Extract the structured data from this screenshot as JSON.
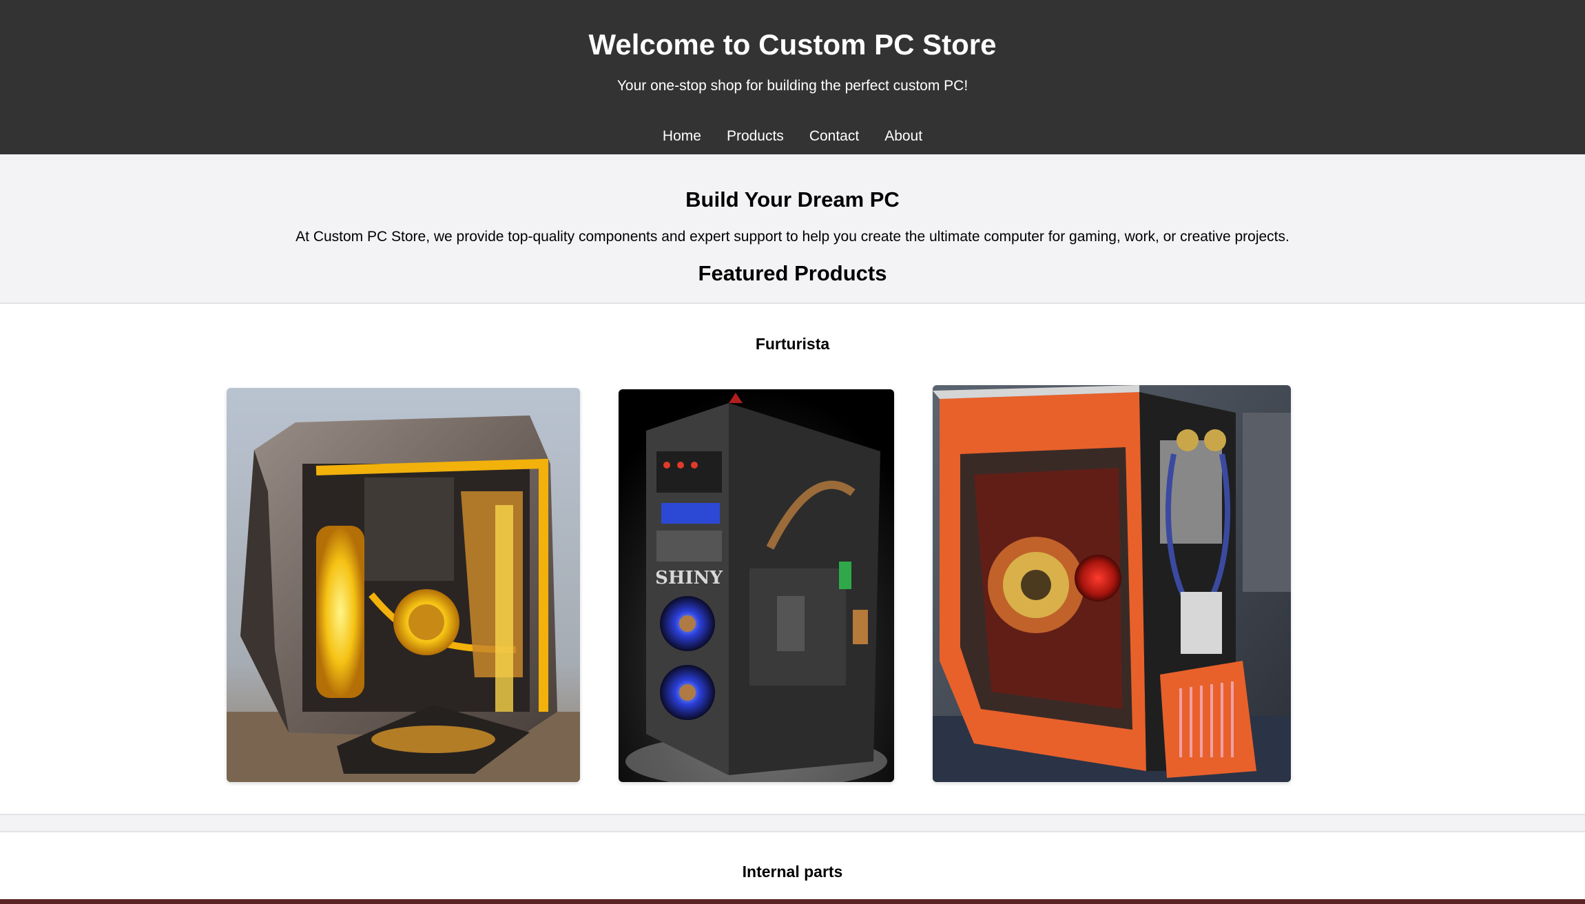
{
  "header": {
    "title": "Welcome to Custom PC Store",
    "tagline": "Your one-stop shop for building the perfect custom PC!",
    "nav": [
      {
        "label": "Home"
      },
      {
        "label": "Products"
      },
      {
        "label": "Contact"
      },
      {
        "label": "About"
      }
    ]
  },
  "intro": {
    "heading": "Build Your Dream PC",
    "text": "At Custom PC Store, we provide top-quality components and expert support to help you create the ultimate computer for gaming, work, or creative projects.",
    "featured_heading": "Featured Products"
  },
  "sections": [
    {
      "title": "Furturista",
      "products": [
        {
          "image": "steampunk-copper-watercooled-pc-case-image"
        },
        {
          "image": "black-shiny-steampunk-tower-pc-image"
        },
        {
          "image": "orange-ornate-case-mod-pc-image"
        }
      ]
    },
    {
      "title": "Internal parts"
    }
  ],
  "product_art_text": {
    "case_badge": "SHINY"
  },
  "colors": {
    "header_bg": "#333333",
    "page_bg": "#f3f3f6",
    "section_bg": "#ffffff",
    "bottom_strip": "#5a2426"
  }
}
